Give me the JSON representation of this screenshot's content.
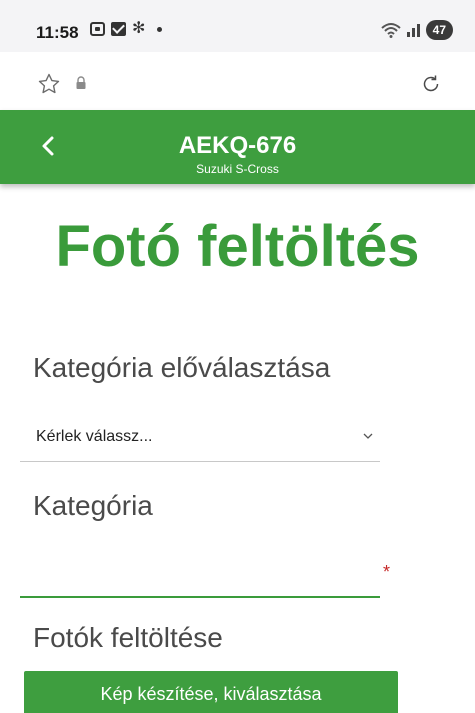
{
  "status_bar": {
    "time": "11:58",
    "battery": "47",
    "left_icons": [
      "screen-record-icon",
      "mail-icon",
      "flower-icon",
      "notification-dot"
    ],
    "right_icons": [
      "wifi-icon",
      "signal-icon",
      "battery-icon"
    ]
  },
  "browser": {
    "icons": [
      "star-icon",
      "lock-icon",
      "reload-icon"
    ]
  },
  "header": {
    "back_icon": "chevron-left-icon",
    "plate": "AEKQ-676",
    "car_model": "Suzuki S-Cross",
    "color": "#3e9e3f"
  },
  "page": {
    "title": "Fotó feltöltés",
    "title_color": "#3a9b3b"
  },
  "form": {
    "preselect_label": "Kategória előválasztása",
    "preselect_value": "Kérlek válassz...",
    "category_label": "Kategória",
    "category_value": "",
    "required_mark": "*",
    "photos_label": "Fotók feltöltése",
    "photo_button_label": "Kép készítése, kiválasztása"
  }
}
